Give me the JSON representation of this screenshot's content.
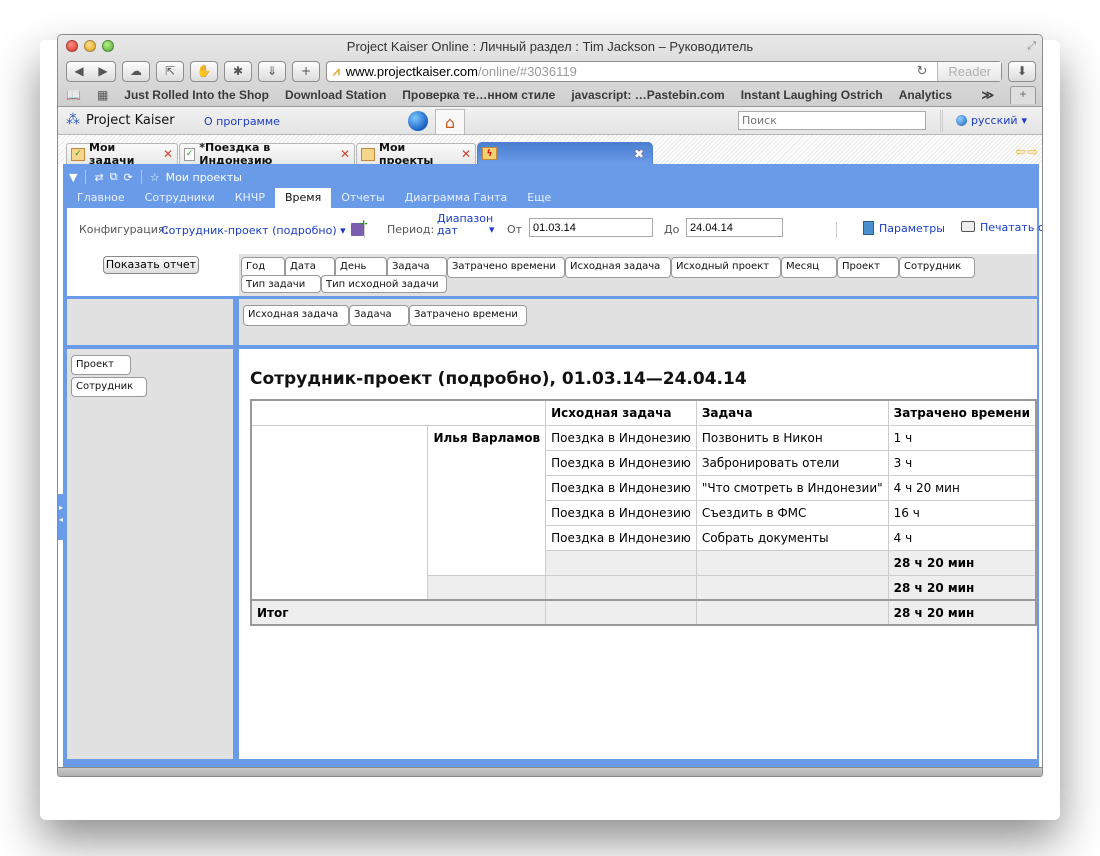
{
  "browser": {
    "title": "Project Kaiser Online : Личный раздел : Tim Jackson – Руководитель",
    "url_host": "www.projectkaiser.com",
    "url_path": "/online/#3036119",
    "reader_label": "Reader",
    "bookmarks": [
      "Just Rolled Into the Shop",
      "Download Station",
      "Проверка те…нном стиле",
      "javascript: …Pastebin.com",
      "Instant Laughing Ostrich",
      "Analytics"
    ],
    "bookmarks_more": "≫",
    "new_tab": "+"
  },
  "app": {
    "logo": "Project Kaiser",
    "about_link": "О программе",
    "search_placeholder": "Поиск",
    "language": "русский"
  },
  "tabs": [
    {
      "label": "Мои задачи",
      "icon": "task-folder-icon"
    },
    {
      "label": "*Поездка в Индонезию",
      "icon": "document-check-icon"
    },
    {
      "label": "Мои проекты",
      "icon": "project-folder-icon"
    },
    {
      "label": "",
      "icon": "report-folder-icon",
      "active": true
    }
  ],
  "toolbar": {
    "favorite_label": "Мои проекты"
  },
  "nav": [
    {
      "label": "Главное"
    },
    {
      "label": "Сотрудники"
    },
    {
      "label": "КНЧР"
    },
    {
      "label": "Время",
      "active": true
    },
    {
      "label": "Отчеты"
    },
    {
      "label": "Диаграмма Ганта"
    },
    {
      "label": "Еще"
    }
  ],
  "config": {
    "config_label": "Конфигурация:",
    "config_value": "Сотрудник-проект (подробно)",
    "period_label": "Период:",
    "period_value_line1": "Диапазон",
    "period_value_line2": "дат",
    "from_label": "От",
    "from_value": "01.03.14",
    "to_label": "До",
    "to_value": "24.04.14",
    "params_label": "Параметры",
    "print_label": "Печатать от"
  },
  "show_report_button": "Показать отчет",
  "available_fields": [
    "Год",
    "Дата",
    "День",
    "Задача",
    "Затрачено времени",
    "Исходная задача",
    "Исходный проект",
    "Месяц",
    "Проект",
    "Сотрудник",
    "Тип задачи",
    "Тип исходной задачи"
  ],
  "column_fields": [
    "Исходная задача",
    "Задача",
    "Затрачено времени"
  ],
  "row_fields": [
    "Проект",
    "Сотрудник"
  ],
  "report": {
    "title": "Сотрудник-проект (подробно), 01.03.14—24.04.14",
    "headers": [
      "",
      "",
      "Исходная задача",
      "Задача",
      "Затрачено времени"
    ],
    "employee": "Илья Варламов",
    "rows": [
      {
        "source_task": "Поездка в Индонезию",
        "task": "Позвонить в Никон",
        "time": "1 ч"
      },
      {
        "source_task": "Поездка в Индонезию",
        "task": "Забронировать отели",
        "time": "3 ч"
      },
      {
        "source_task": "Поездка в Индонезию",
        "task": "\"Что смотреть в Индонезии\"",
        "time": "4 ч 20 мин"
      },
      {
        "source_task": "Поездка в Индонезию",
        "task": "Съездить в ФМС",
        "time": "16 ч"
      },
      {
        "source_task": "Поездка в Индонезию",
        "task": "Собрать документы",
        "time": "4 ч"
      }
    ],
    "employee_subtotal_label": "Илья Варламов",
    "employee_subtotal": "28 ч 20 мин",
    "project_subtotal": "28 ч 20 мин",
    "total_label": "Итог",
    "total": "28 ч 20 мин"
  }
}
